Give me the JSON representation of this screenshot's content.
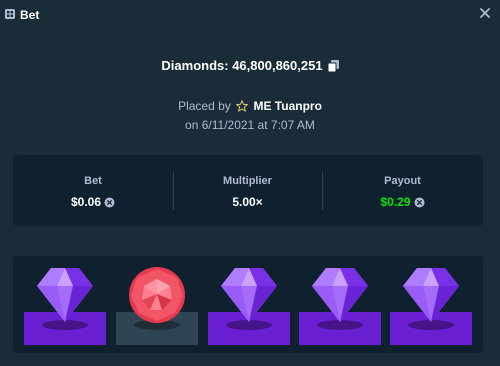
{
  "header": {
    "title": "Bet",
    "bet_icon": "bet-icon",
    "close_icon": "close-icon"
  },
  "summary": {
    "diamonds_label": "Diamonds: 46,800,860,251",
    "copy_icon": "copy-icon",
    "placed_prefix": "Placed by",
    "star_icon": "star-icon",
    "username": "ME Tuanpro",
    "date_line": "on 6/11/2021 at 7:07 AM"
  },
  "stats": {
    "bet_label": "Bet",
    "bet_value": "$0.06",
    "multiplier_label": "Multiplier",
    "multiplier_value": "5.00×",
    "payout_label": "Payout",
    "payout_value": "$0.29",
    "coin_icon": "coin-icon"
  },
  "board": {
    "tiles": [
      {
        "gem": "purple-diamond"
      },
      {
        "gem": "red-gem"
      },
      {
        "gem": "purple-diamond"
      },
      {
        "gem": "purple-diamond"
      },
      {
        "gem": "purple-diamond"
      }
    ]
  },
  "colors": {
    "background": "#1a2c38",
    "panel": "#0f212e",
    "payout_green": "#00e701",
    "pad_purple": "#6b1fd3",
    "pad_slate": "#2f4553",
    "muted_text": "#b1bad3"
  }
}
